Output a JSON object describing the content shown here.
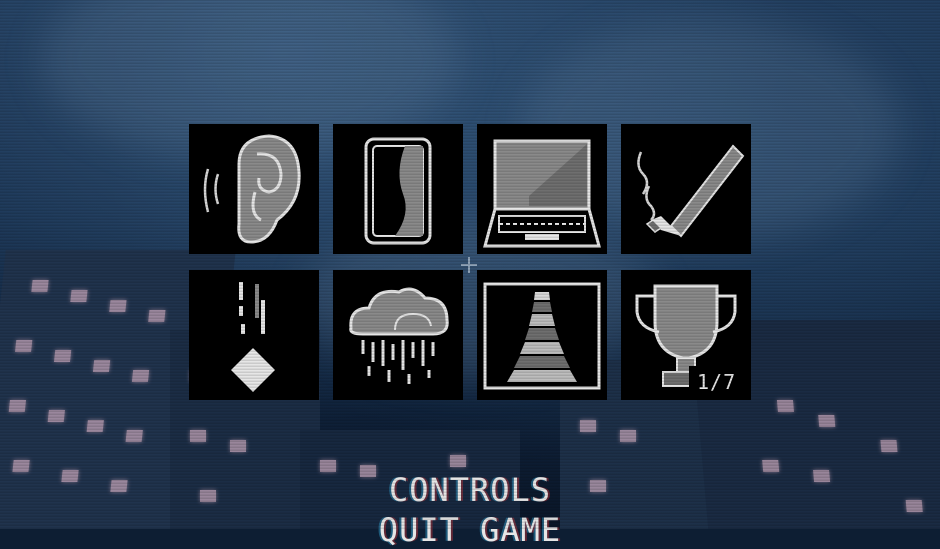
{
  "tiles": [
    {
      "icon": "ear-icon"
    },
    {
      "icon": "soda-can-icon"
    },
    {
      "icon": "laptop-icon"
    },
    {
      "icon": "cigarette-icon"
    },
    {
      "icon": "falling-drop-icon"
    },
    {
      "icon": "rain-cloud-icon"
    },
    {
      "icon": "stairway-icon"
    },
    {
      "icon": "trophy-icon"
    }
  ],
  "trophy_counter": "1/7",
  "menu": {
    "controls": "CONTROLS",
    "quit": "QUIT GAME"
  },
  "colors": {
    "tile_bg": "#000000",
    "icon_light": "#e6e6e6",
    "icon_gray": "#8a8a8a",
    "window_glow": "#c3a4b8"
  }
}
